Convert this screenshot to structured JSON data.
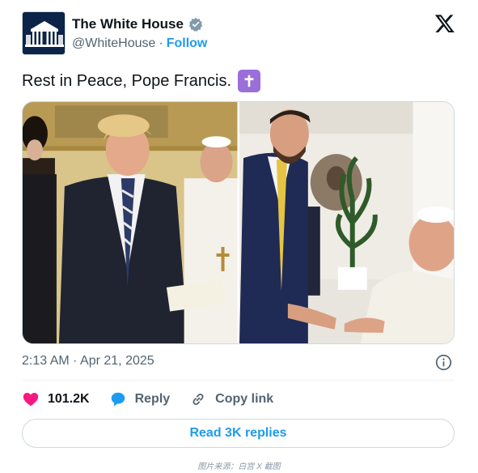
{
  "author": {
    "display_name": "The White House",
    "handle": "@WhiteHouse",
    "separator": "·",
    "follow_label": "Follow",
    "verified": true
  },
  "tweet": {
    "text": "Rest in Peace, Pope Francis.",
    "emoji": "latin-cross-emoji",
    "timestamp": "2:13 AM · Apr 21, 2025"
  },
  "media": {
    "photos": [
      {
        "name": "photo-trump-with-pope"
      },
      {
        "name": "photo-vance-with-pope"
      }
    ]
  },
  "actions": {
    "likes_count": "101.2K",
    "reply_label": "Reply",
    "copy_link_label": "Copy link",
    "read_replies_label": "Read 3K replies"
  },
  "footer": {
    "caption": "图片来源：白宫 X 截图"
  },
  "colors": {
    "accent": "#1d9bf0",
    "like": "#f91880",
    "text": "#0f1419",
    "muted": "#536471",
    "border": "#cfd9de",
    "emoji_bg": "#9b6fd9"
  }
}
